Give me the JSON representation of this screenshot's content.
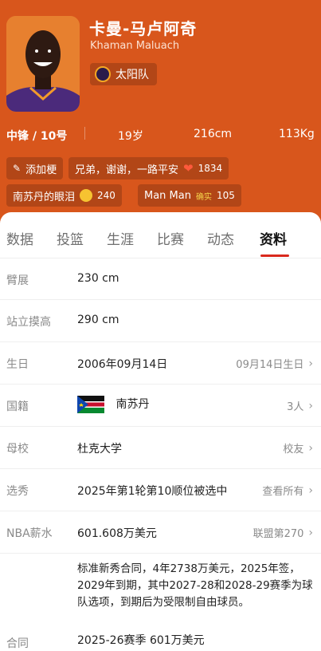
{
  "player": {
    "name_cn": "卡曼-马卢阿奇",
    "name_en": "Khaman Maluach",
    "team": "太阳队",
    "stats": {
      "position": "中锋 / 10号",
      "age": "19岁",
      "height": "216cm",
      "weight": "113Kg"
    }
  },
  "tags": {
    "add_tag": "添加梗",
    "tag1": {
      "text": "兄弟，谢谢，一路平安",
      "count": "1834"
    },
    "tag2": {
      "text": "南苏丹的眼泪",
      "count": "240"
    },
    "tag3": {
      "text": "Man Man",
      "badge": "确实",
      "count": "105"
    }
  },
  "tabs": [
    "数据",
    "投篮",
    "生涯",
    "比赛",
    "动态",
    "资料"
  ],
  "active_tab": "资料",
  "profile": {
    "wingspan": {
      "label": "臂展",
      "value": "230 cm"
    },
    "reach": {
      "label": "站立摸高",
      "value": "290 cm"
    },
    "birthday": {
      "label": "生日",
      "value": "2006年09月14日",
      "right": "09月14日生日"
    },
    "nationality": {
      "label": "国籍",
      "value": "南苏丹",
      "right": "3人"
    },
    "college": {
      "label": "母校",
      "value": "杜克大学",
      "right": "校友"
    },
    "draft": {
      "label": "选秀",
      "value": "2025年第1轮第10顺位被选中",
      "right": "查看所有"
    },
    "salary": {
      "label": "NBA薪水",
      "value": "601.608万美元",
      "right": "联盟第270"
    },
    "contract": {
      "label": "合同",
      "text": "标准新秀合同，4年2738万美元，2025年签，2029年到期，其中2027-28和2028-29赛季为球队选项，到期后为受限制自由球员。",
      "season": "2025-26赛季 601万美元"
    }
  },
  "colors": {
    "header": "#d8561c",
    "accent": "#d9281c"
  }
}
